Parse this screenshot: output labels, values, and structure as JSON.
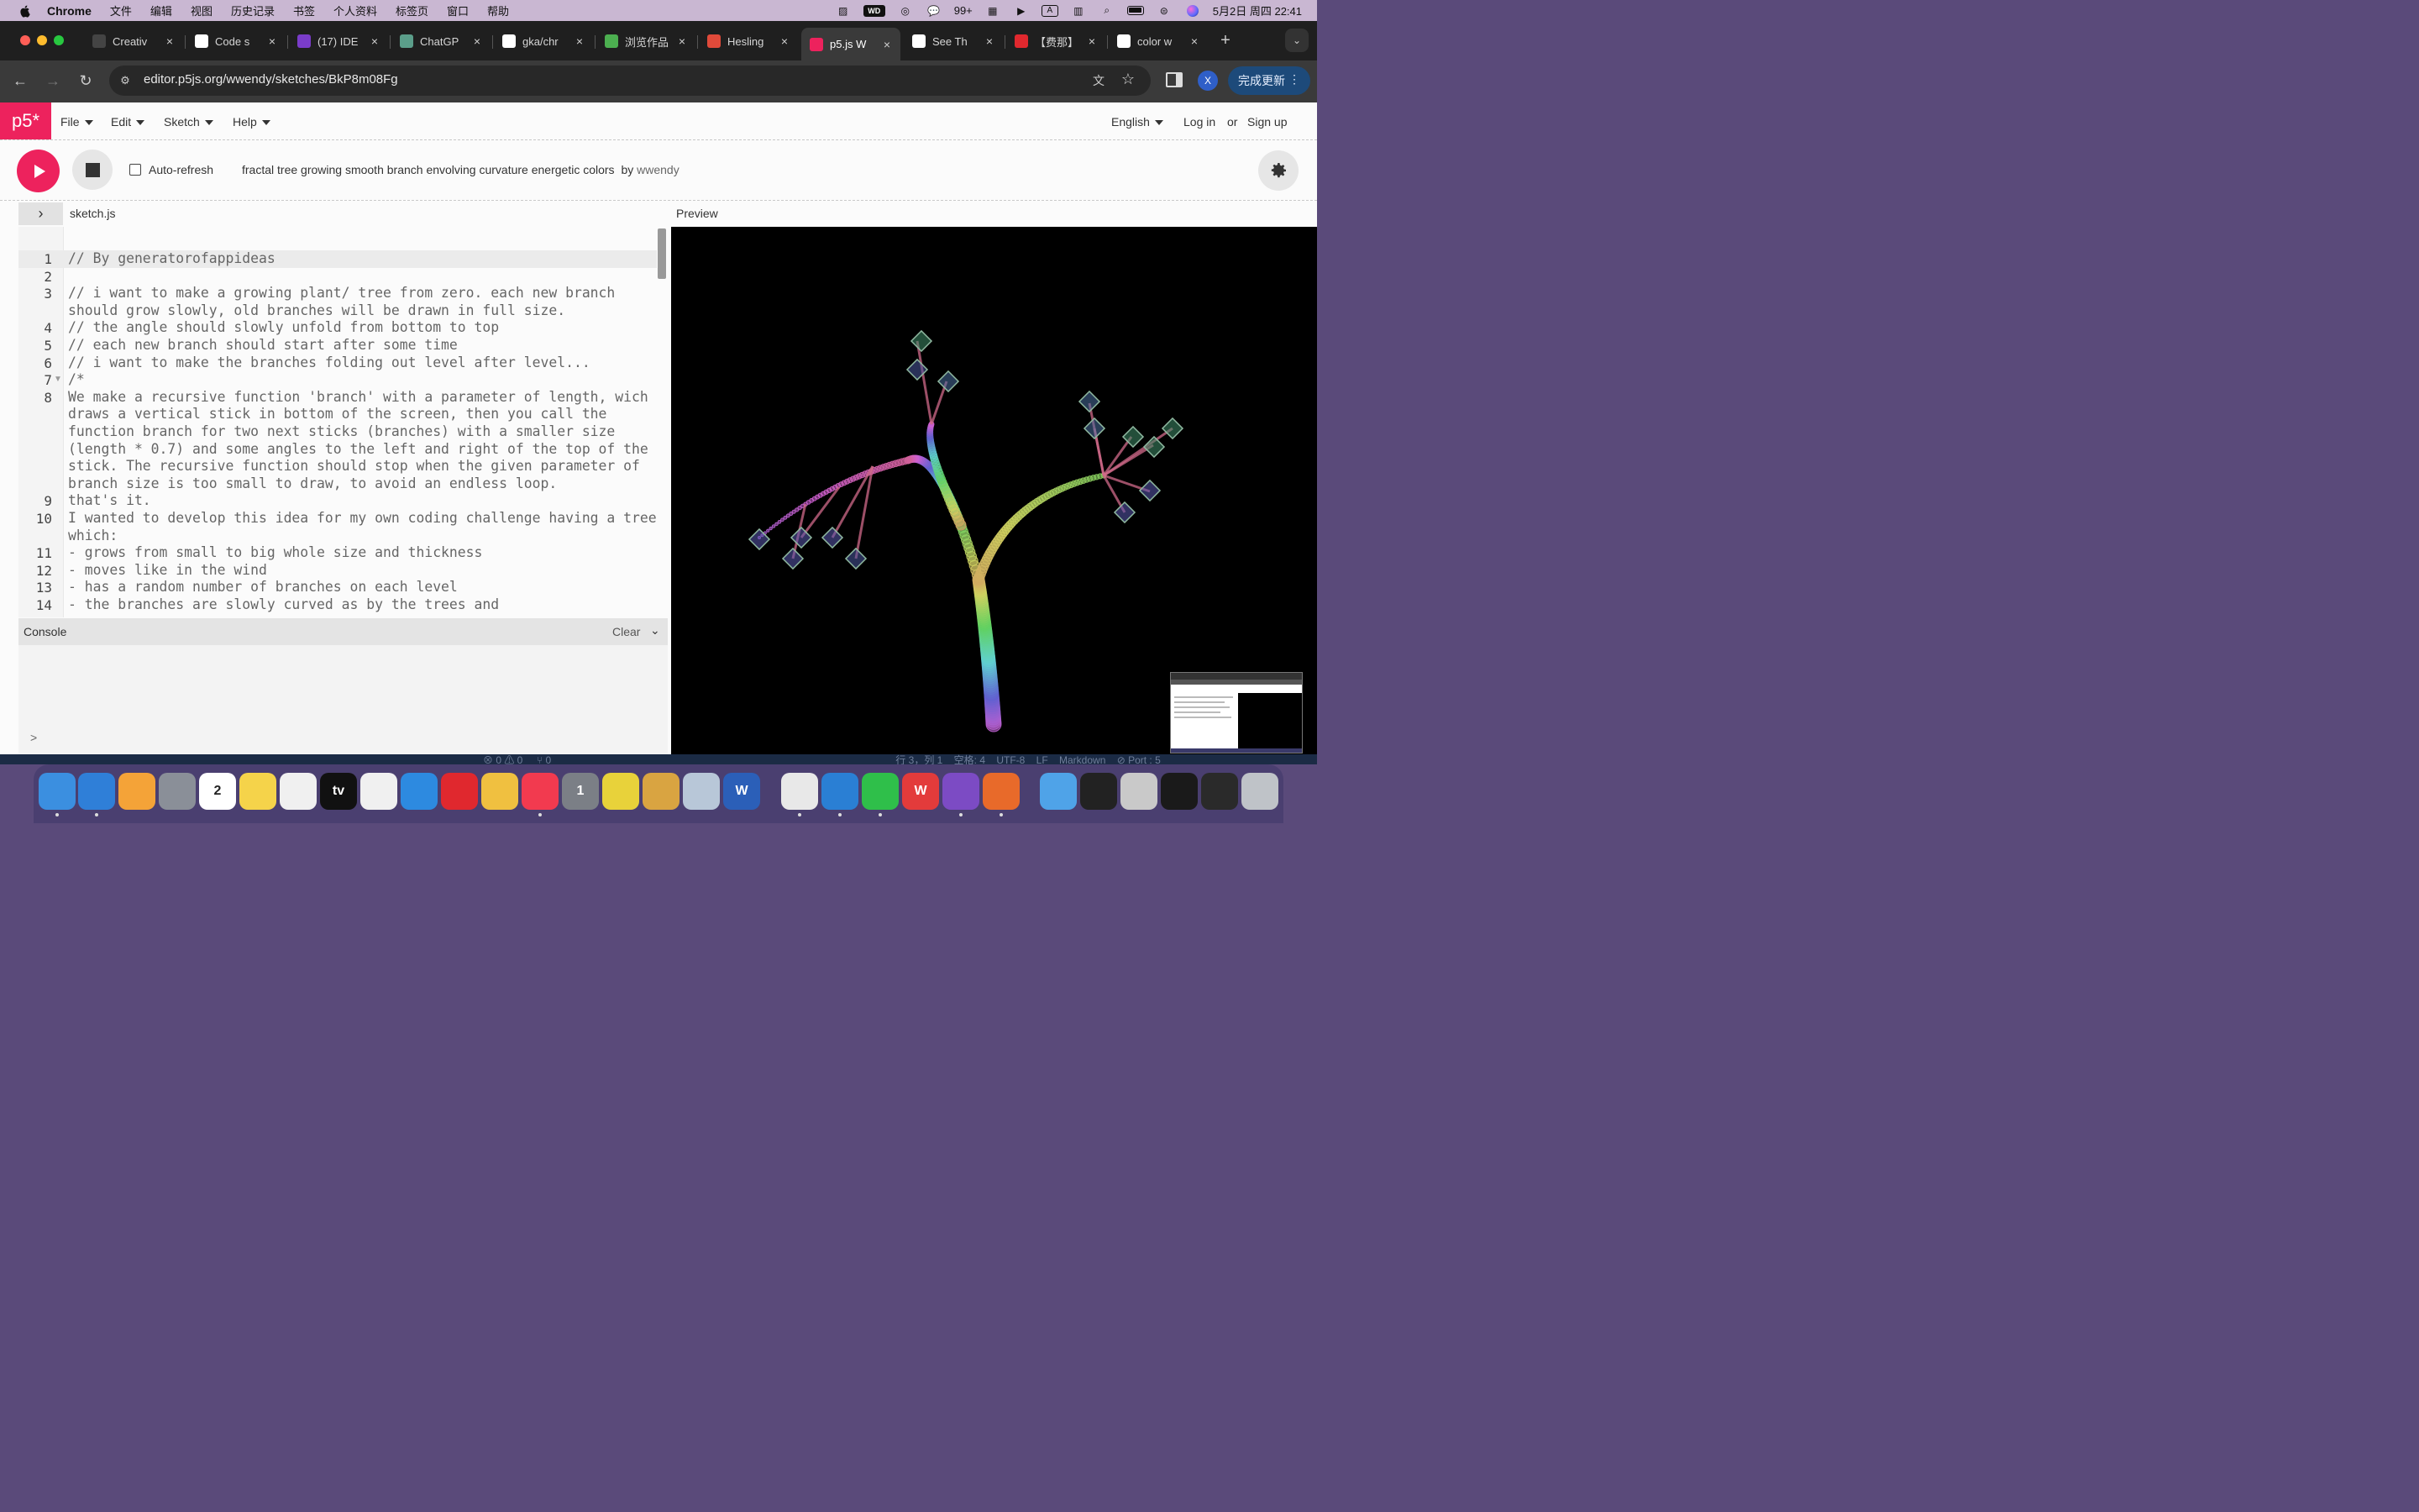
{
  "menubar": {
    "app_name": "Chrome",
    "items": [
      "文件",
      "编辑",
      "视图",
      "历史记录",
      "书签",
      "个人资料",
      "标签页",
      "窗口",
      "帮助"
    ],
    "wechat_badge": "99+",
    "datetime": "5月2日 周四  22:41"
  },
  "browser": {
    "tabs": [
      {
        "label": "Creativ",
        "icon": "codepen-icon",
        "color": "#444"
      },
      {
        "label": "Code s",
        "icon": "github-icon",
        "color": "#ffffff"
      },
      {
        "label": "(17) IDE",
        "icon": "ed-icon",
        "color": "#7a3cc9"
      },
      {
        "label": "ChatGP",
        "icon": "chatgpt-icon",
        "color": "#5b9e8a"
      },
      {
        "label": "gka/chr",
        "icon": "github-icon",
        "color": "#ffffff"
      },
      {
        "label": "浏览作品",
        "icon": "browse-icon",
        "color": "#4caf50"
      },
      {
        "label": "Hesling",
        "icon": "target-icon",
        "color": "#e04a3a"
      },
      {
        "label": "p5.js W",
        "icon": "p5-asterisk-icon",
        "color": "#ed225d",
        "active": true
      },
      {
        "label": "See Th",
        "icon": "medium-icon",
        "color": "#ffffff"
      },
      {
        "label": "【费那】",
        "icon": "red-app-icon",
        "color": "#e0282e"
      },
      {
        "label": "color w",
        "icon": "google-icon",
        "color": "#ffffff"
      }
    ],
    "url": "editor.p5js.org/wwendy/sketches/BkP8m08Fg",
    "profile_initial": "X",
    "update_button": "完成更新"
  },
  "editor": {
    "logo": "p5*",
    "menus": [
      "File",
      "Edit",
      "Sketch",
      "Help"
    ],
    "language": "English",
    "login": "Log in",
    "or": "or",
    "signup": "Sign up",
    "auto_refresh_label": "Auto-refresh",
    "auto_refresh_checked": false,
    "sketch_title": "fractal tree growing smooth branch envolving curvature energetic colors",
    "by": "by",
    "author": "wwendy",
    "filename": "sketch.js",
    "preview_label": "Preview",
    "console_label": "Console",
    "clear_label": "Clear",
    "console_prompt": ">"
  },
  "code_lines": [
    {
      "n": "1",
      "text": "// By generatorofappideas"
    },
    {
      "n": "2",
      "text": ""
    },
    {
      "n": "3",
      "text": "// i want to make a growing plant/ tree from zero. each new branch\nshould grow slowly, old branches will be drawn in full size."
    },
    {
      "n": "4",
      "text": "// the angle should slowly unfold from bottom to top"
    },
    {
      "n": "5",
      "text": "// each new branch should start after some time"
    },
    {
      "n": "6",
      "text": "// i want to make the branches folding out level after level..."
    },
    {
      "n": "7",
      "text": "/*"
    },
    {
      "n": "8",
      "text": "We make a recursive function 'branch' with a parameter of length, wich\ndraws a vertical stick in bottom of the screen, then you call the\nfunction branch for two next sticks (branches) with a smaller size\n(length * 0.7) and some angles to the left and right of the top of the\nstick. The recursive function should stop when the given parameter of\nbranch size is too small to draw, to avoid an endless loop."
    },
    {
      "n": "9",
      "text": "that's it."
    },
    {
      "n": "10",
      "text": "I wanted to develop this idea for my own coding challenge having a tree\nwhich:"
    },
    {
      "n": "11",
      "text": "- grows from small to big whole size and thickness"
    },
    {
      "n": "12",
      "text": "- moves like in the wind"
    },
    {
      "n": "13",
      "text": "- has a random number of branches on each level"
    },
    {
      "n": "14",
      "text": "- the branches are slowly curved as by the trees and"
    }
  ],
  "ide_status": "⊗ 0 ⚠ 0     ⑂ 0                                                                                                                           行 3，列 1    空格: 4    UTF-8    LF    Markdown    ⊘ Port : 5",
  "dock": [
    {
      "name": "finder",
      "label": "",
      "color": "#3b8fe0"
    },
    {
      "name": "safari",
      "label": "",
      "color": "#2f7fd8"
    },
    {
      "name": "pages",
      "label": "",
      "color": "#f4a338"
    },
    {
      "name": "launchpad",
      "label": "",
      "color": "#8a8f98"
    },
    {
      "name": "calendar",
      "label": "2",
      "color": "#ffffff"
    },
    {
      "name": "notes",
      "label": "",
      "color": "#f5d34a"
    },
    {
      "name": "freeform",
      "label": "",
      "color": "#f0f0f0"
    },
    {
      "name": "apple-tv",
      "label": "tv",
      "color": "#111111"
    },
    {
      "name": "reminders",
      "label": "",
      "color": "#f0f0f0"
    },
    {
      "name": "keynote",
      "label": "",
      "color": "#2d8ae0"
    },
    {
      "name": "netease-music",
      "label": "",
      "color": "#e0282e"
    },
    {
      "name": "photos",
      "label": "",
      "color": "#f0c040"
    },
    {
      "name": "music",
      "label": "",
      "color": "#f23a4f"
    },
    {
      "name": "system-settings",
      "label": "1",
      "color": "#7b7f86"
    },
    {
      "name": "app-green",
      "label": "",
      "color": "#e8d23a"
    },
    {
      "name": "cocktail",
      "label": "",
      "color": "#d9a441"
    },
    {
      "name": "preview-app",
      "label": "",
      "color": "#b8c7d8"
    },
    {
      "name": "word",
      "label": "W",
      "color": "#2b5fb8"
    },
    {
      "name": "chrome",
      "label": "",
      "color": "#e8e8e8"
    },
    {
      "name": "vscode",
      "label": "",
      "color": "#2a7fd4"
    },
    {
      "name": "wechat",
      "label": "",
      "color": "#2fbf4a"
    },
    {
      "name": "wps",
      "label": "W",
      "color": "#e33b3b"
    },
    {
      "name": "github-desktop",
      "label": "",
      "color": "#7c4bc4"
    },
    {
      "name": "matlab",
      "label": "",
      "color": "#e86a2a"
    },
    {
      "name": "folder",
      "label": "",
      "color": "#4fa3e8"
    },
    {
      "name": "window-1",
      "label": "",
      "color": "#222222"
    },
    {
      "name": "window-2",
      "label": "",
      "color": "#c9c9c9"
    },
    {
      "name": "window-3",
      "label": "",
      "color": "#1a1a1a"
    },
    {
      "name": "window-4",
      "label": "",
      "color": "#2a2a2a"
    },
    {
      "name": "trash",
      "label": "",
      "color": "#bfc3c8"
    }
  ],
  "colors": {
    "p5_pink": "#ed225d",
    "tab_active": "#3a3a3a",
    "tab_strip": "#1f1f1f",
    "preview_bg": "#000000"
  }
}
